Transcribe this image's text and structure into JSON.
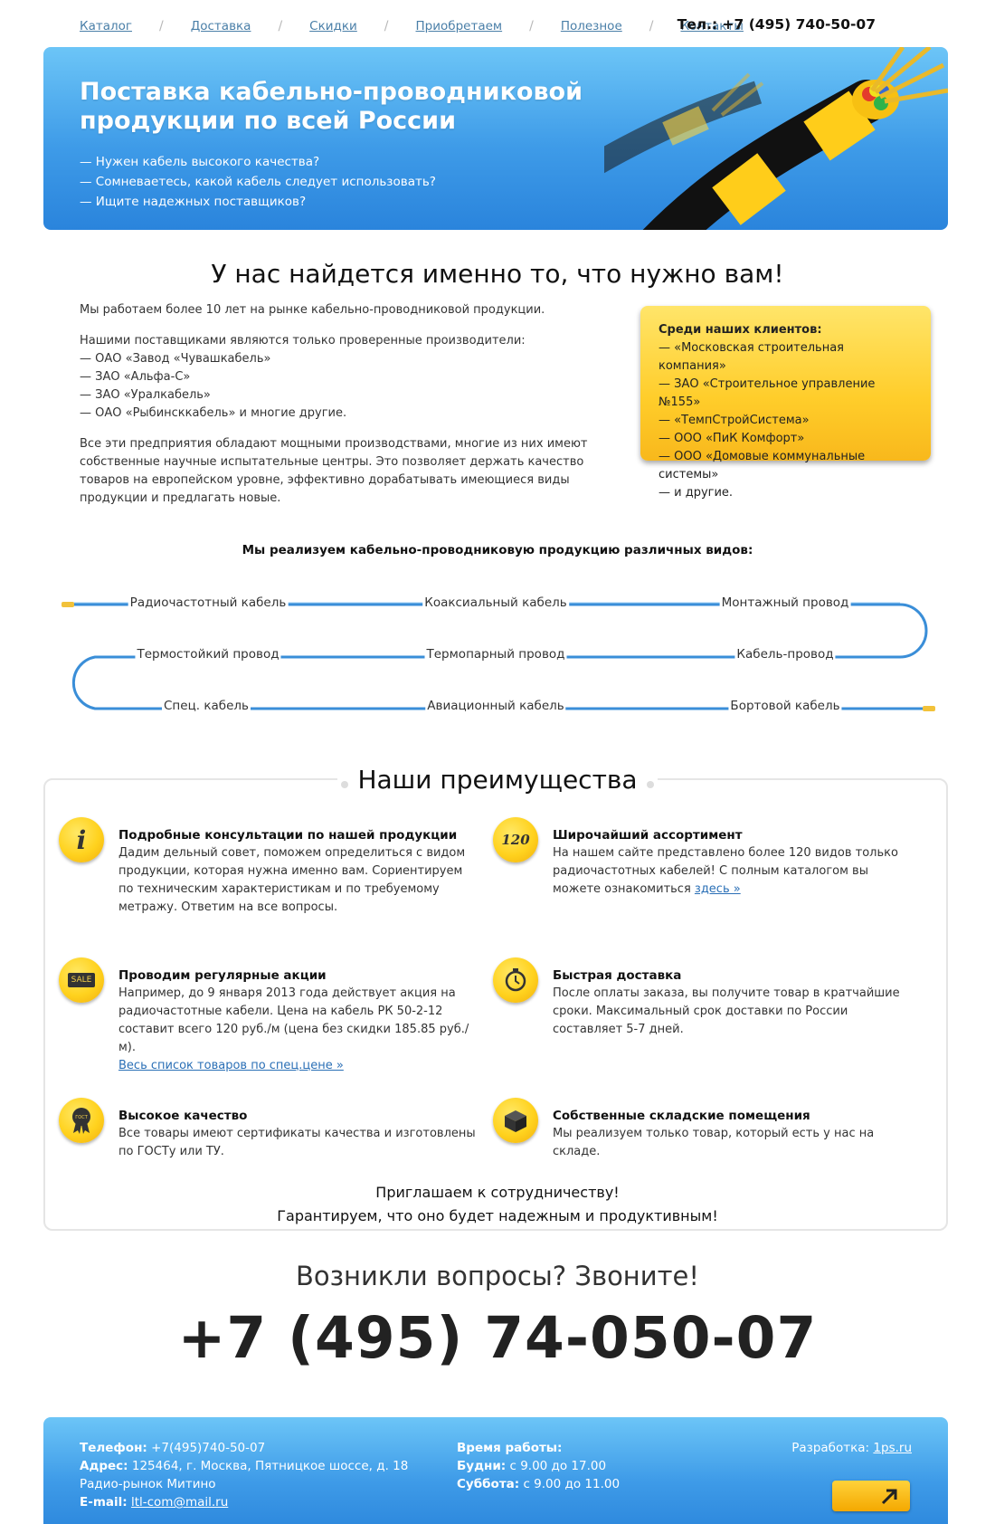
{
  "nav": {
    "items": [
      "Каталог",
      "Доставка",
      "Скидки",
      "Приобретаем",
      "Полезное",
      "Контакты"
    ],
    "phone": "Тел.: +7 (495) 740-50-07"
  },
  "banner": {
    "title": "Поставка кабельно-проводниковой продукции по всей России",
    "bullets": [
      "— Нужен кабель высокого качества?",
      "— Сомневаетесь, какой кабель следует использовать?",
      "— Ищите надежных поставщиков?"
    ]
  },
  "intro": {
    "heading": "У нас найдется именно то, что нужно вам!",
    "p1": "Мы работаем более 10 лет на рынке кабельно-проводниковой продукции.",
    "p2_lead": "Нашими поставщиками являются только проверенные производители:",
    "suppliers": [
      "— ОАО «Завод «Чувашкабель»",
      "— ЗАО «Альфа-С»",
      "— ЗАО «Уралкабель»",
      "— ОАО «Рыбинсккабель» и многие другие."
    ],
    "p3": "Все эти предприятия обладают мощными производствами, многие из них имеют собственные научные испытательные центры. Это позволяет держать качество товаров на европейском уровне, эффективно дорабатывать имеющиеся виды продукции и предлагать новые."
  },
  "clients": {
    "title": "Среди наших клиентов:",
    "items": [
      "— «Московская строительная компания»",
      "— ЗАО «Строительное управление №155»",
      "— «ТемпСтройСистема»",
      "— ООО «ПиК Комфорт»",
      "— ООО «Домовые коммунальные системы»",
      "— и другие."
    ]
  },
  "products": {
    "heading": "Мы реализуем кабельно-проводниковую продукцию различных видов:",
    "items": [
      "Радиочастотный кабель",
      "Коаксиальный кабель",
      "Монтажный провод",
      "Термостойкий провод",
      "Термопарный провод",
      "Кабель-провод",
      "Спец. кабель",
      "Авиационный кабель",
      "Бортовой кабель"
    ]
  },
  "advantages": {
    "heading": "Наши преимущества",
    "items": [
      {
        "title": "Подробные консультации по нашей продукции",
        "text": "Дадим дельный совет, поможем определиться с видом продукции, которая нужна именно вам. Сориентируем по техническим характеристикам и по требуемому метражу. Ответим на все вопросы.",
        "icon": "info-icon",
        "icon_text": "i"
      },
      {
        "title": "Широчайший ассортимент",
        "text": "На нашем сайте представлено более 120 видов только радиочастотных кабелей! С полным каталогом вы можете ознакомиться ",
        "link": "здесь »",
        "icon": "assortment-120-icon",
        "icon_text": "120"
      },
      {
        "title": "Проводим регулярные акции",
        "text": "Например, до 9 января 2013 года действует акция на радиочастотные кабели. Цена на кабель РК 50-2-12 составит всего 120 руб./м (цена без скидки 185.85 руб./м).",
        "link": "Весь список товаров по спец.цене »",
        "icon": "sale-icon",
        "icon_text": "SALE"
      },
      {
        "title": "Быстрая доставка",
        "text": "После оплаты заказа, вы получите товар в кратчайшие сроки. Максимальный срок доставки по России составляет 5-7 дней.",
        "icon": "clock-icon"
      },
      {
        "title": "Высокое качество",
        "text": "Все товары имеют сертификаты качества и изготовлены по ГОСТу или ТУ.",
        "icon": "gost-seal-icon",
        "icon_text": "ГОСТ"
      },
      {
        "title": "Собственные складские помещения",
        "text": "Мы реализуем только товар, который есть у нас на складе.",
        "icon": "box-icon"
      }
    ],
    "invite1": "Приглашаем к сотрудничеству!",
    "invite2": "Гарантируем, что оно будет надежным и продуктивным!"
  },
  "call": {
    "question": "Возникли вопросы? Звоните!",
    "phone": "+7 (495) 74-050-07"
  },
  "footer": {
    "phone_label": "Телефон:",
    "phone": " +7(495)740-50-07",
    "address_label": "Адрес:",
    "address": " 125464, г. Москва, Пятницкое шоссе, д. 18",
    "address2": "Радио-рынок Митино",
    "email_label": "E-mail:",
    "email": "ltl-com@mail.ru",
    "hours_title": "Время работы:",
    "weekdays_label": "Будни:",
    "weekdays": " с 9.00 до 17.00",
    "saturday_label": "Суббота:",
    "saturday": " с 9.00 до 11.00",
    "dev_label": "Разработка:",
    "dev_link": "1ps.ru"
  },
  "colors": {
    "accent_blue": "#3e9be8",
    "accent_yellow": "#ffcd2a"
  }
}
